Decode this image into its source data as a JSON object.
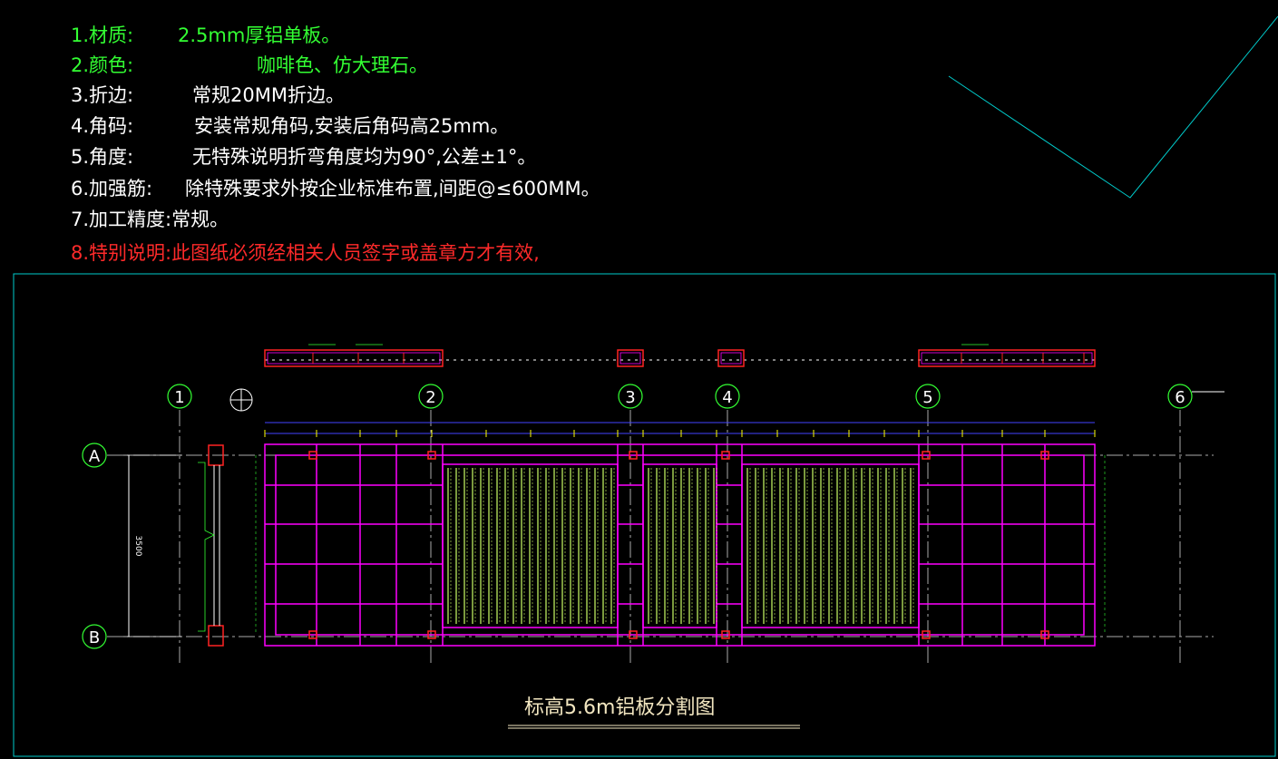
{
  "notes": [
    {
      "label": "1.材质:",
      "value": "2.5mm厚铝单板。",
      "color": "#33ff33"
    },
    {
      "label": "2.颜色:",
      "value": "咖啡色、仿大理石。",
      "color": "#33ff33"
    },
    {
      "label": "3.折边:",
      "value": "常规20MM折边。",
      "color": "#ffffff"
    },
    {
      "label": "4.角码:",
      "value": "安装常规角码,安装后角码高25mm。",
      "color": "#ffffff"
    },
    {
      "label": "5.角度:",
      "value": "无特殊说明折弯角度均为90°,公差±1°。",
      "color": "#ffffff"
    },
    {
      "label": "6.加强筋:",
      "value": "除特殊要求外按企业标准布置,间距@≤600MM。",
      "color": "#ffffff"
    },
    {
      "label": "7.加工精度:常规。",
      "value": "",
      "color": "#ffffff"
    },
    {
      "label": "8.特别说明:此图纸必须经相关人员签字或盖章方才有效,",
      "value": "",
      "color": "#ff2a2a"
    }
  ],
  "axes": {
    "columns": [
      "1",
      "2",
      "3",
      "4",
      "5",
      "6"
    ],
    "rows": [
      "A",
      "B"
    ]
  },
  "dimension_label": "3500",
  "caption": "标高5.6m铝板分割图",
  "colors": {
    "background": "#000000",
    "frame": "#00cccc",
    "panel_grid": "#ff00ff",
    "anchor": "#ff2222",
    "hatch": "#ccff66",
    "axis": "#33ff33",
    "dimension": "#4444ff"
  }
}
